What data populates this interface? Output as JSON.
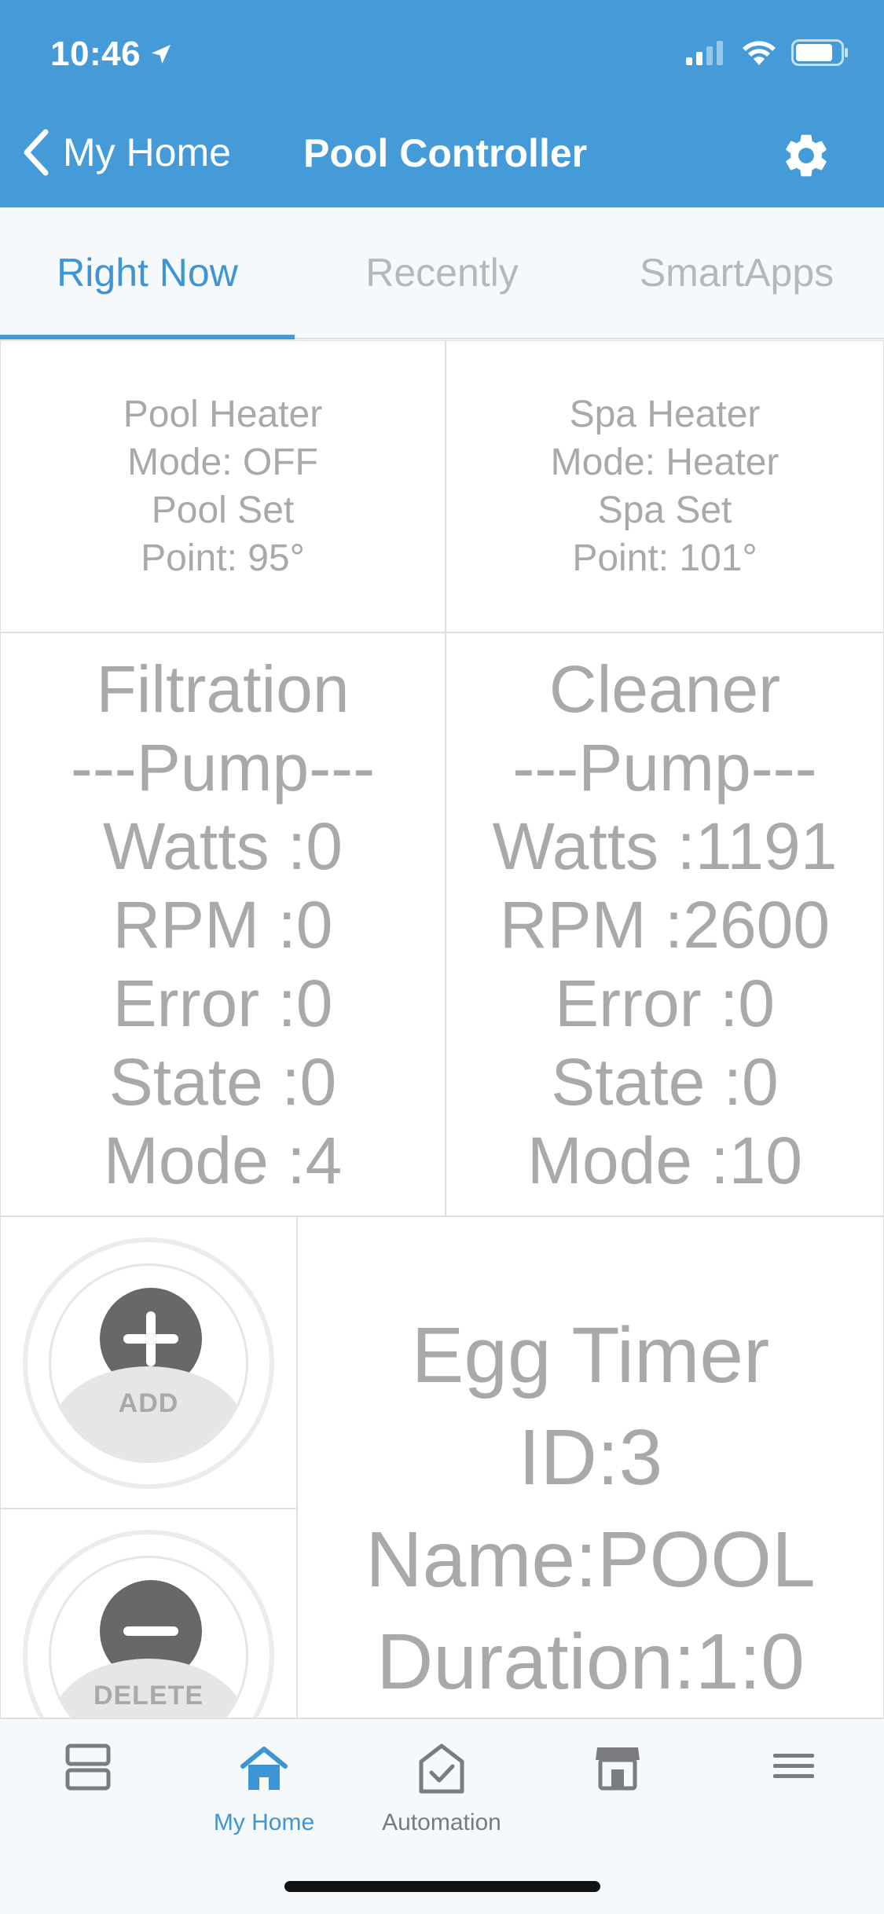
{
  "status": {
    "time": "10:46"
  },
  "nav": {
    "back_label": "My Home",
    "title": "Pool Controller"
  },
  "tabs": [
    {
      "label": "Right Now",
      "active": true
    },
    {
      "label": "Recently",
      "active": false
    },
    {
      "label": "SmartApps",
      "active": false
    }
  ],
  "tiles": {
    "pool_heater": "Pool Heater\nMode: OFF\nPool Set\nPoint: 95°",
    "spa_heater": "Spa Heater\nMode: Heater\nSpa Set\nPoint: 101°",
    "filtration_pump": "Filtration\n---Pump---\nWatts :0\nRPM :0\nError :0\nState :0\nMode :4",
    "cleaner_pump": "Cleaner\n---Pump---\nWatts :1191\nRPM :2600\nError :0\nState :0\nMode :10",
    "egg_timer": "Egg Timer\nID:3\nName:POOL\nDuration:1:0",
    "add_label": "ADD",
    "delete_label": "DELETE"
  },
  "bottom_nav": [
    {
      "label": "",
      "icon": "dashboard-icon"
    },
    {
      "label": "My Home",
      "icon": "home-icon",
      "active": true
    },
    {
      "label": "Automation",
      "icon": "automation-icon"
    },
    {
      "label": "",
      "icon": "marketplace-icon"
    },
    {
      "label": "",
      "icon": "menu-icon"
    }
  ],
  "colors": {
    "header_blue": "#449bd8",
    "active_blue": "#3e95d2",
    "tile_text": "#a9a9a9",
    "button_dark": "#67686a"
  }
}
